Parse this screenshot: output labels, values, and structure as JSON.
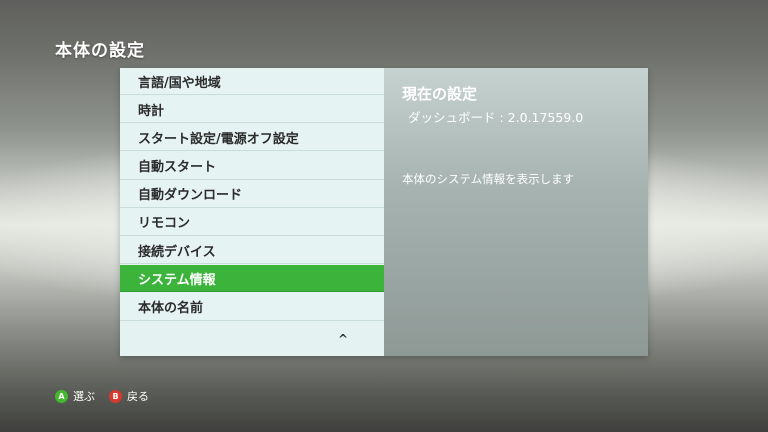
{
  "page": {
    "title": "本体の設定"
  },
  "menu": {
    "items": [
      {
        "label": "言語/国や地域"
      },
      {
        "label": "時計"
      },
      {
        "label": "スタート設定/電源オフ設定"
      },
      {
        "label": "自動スタート"
      },
      {
        "label": "自動ダウンロード"
      },
      {
        "label": "リモコン"
      },
      {
        "label": "接続デバイス"
      },
      {
        "label": "システム情報"
      },
      {
        "label": "本体の名前"
      }
    ],
    "selected_index": 7,
    "scroll_glyph": "^"
  },
  "details": {
    "heading": "現在の設定",
    "version": "ダッシュボード : 2.0.17559.0",
    "description": "本体のシステム情報を表示します"
  },
  "footer": {
    "a_glyph": "A",
    "a_label": "選ぶ",
    "b_glyph": "B",
    "b_label": "戻る"
  },
  "colors": {
    "selected_item": "#3cb43c",
    "a_button": "#46b82f",
    "b_button": "#d63a2c"
  }
}
